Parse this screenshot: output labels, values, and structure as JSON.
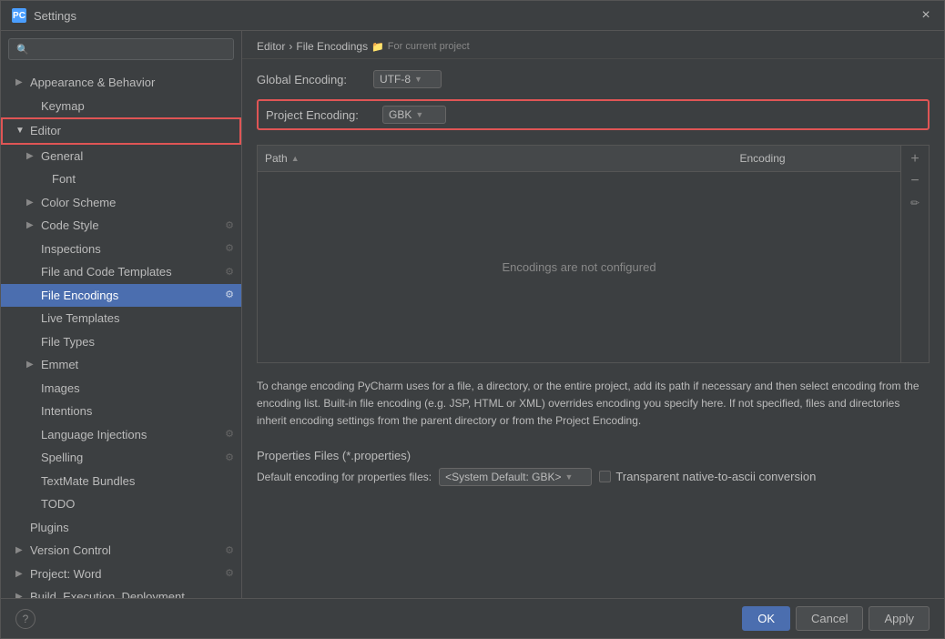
{
  "window": {
    "title": "Settings",
    "close_label": "×"
  },
  "sidebar": {
    "search_placeholder": "",
    "items": [
      {
        "id": "appearance",
        "label": "Appearance & Behavior",
        "level": 0,
        "expandable": true,
        "expanded": false
      },
      {
        "id": "keymap",
        "label": "Keymap",
        "level": 1,
        "expandable": false
      },
      {
        "id": "editor",
        "label": "Editor",
        "level": 0,
        "expandable": true,
        "expanded": true
      },
      {
        "id": "general",
        "label": "General",
        "level": 1,
        "expandable": true,
        "expanded": false
      },
      {
        "id": "font",
        "label": "Font",
        "level": 1,
        "expandable": false
      },
      {
        "id": "colorscheme",
        "label": "Color Scheme",
        "level": 1,
        "expandable": true,
        "expanded": false
      },
      {
        "id": "codestyle",
        "label": "Code Style",
        "level": 1,
        "expandable": true,
        "has_icon": true
      },
      {
        "id": "inspections",
        "label": "Inspections",
        "level": 1,
        "expandable": false,
        "has_icon": true
      },
      {
        "id": "filecodetemplates",
        "label": "File and Code Templates",
        "level": 1,
        "expandable": false,
        "has_icon": true
      },
      {
        "id": "fileencodings",
        "label": "File Encodings",
        "level": 1,
        "expandable": false,
        "selected": true,
        "has_icon": true
      },
      {
        "id": "livetemplates",
        "label": "Live Templates",
        "level": 1,
        "expandable": false
      },
      {
        "id": "filetypes",
        "label": "File Types",
        "level": 1,
        "expandable": false
      },
      {
        "id": "emmet",
        "label": "Emmet",
        "level": 1,
        "expandable": true,
        "expanded": false
      },
      {
        "id": "images",
        "label": "Images",
        "level": 1,
        "expandable": false
      },
      {
        "id": "intentions",
        "label": "Intentions",
        "level": 1,
        "expandable": false
      },
      {
        "id": "languageinjections",
        "label": "Language Injections",
        "level": 1,
        "expandable": false,
        "has_icon": true
      },
      {
        "id": "spelling",
        "label": "Spelling",
        "level": 1,
        "expandable": false,
        "has_icon": true
      },
      {
        "id": "textmatebundles",
        "label": "TextMate Bundles",
        "level": 1,
        "expandable": false
      },
      {
        "id": "todo",
        "label": "TODO",
        "level": 1,
        "expandable": false
      },
      {
        "id": "plugins",
        "label": "Plugins",
        "level": 0,
        "expandable": false
      },
      {
        "id": "versioncontrol",
        "label": "Version Control",
        "level": 0,
        "expandable": true,
        "has_icon": true
      },
      {
        "id": "projectword",
        "label": "Project: Word",
        "level": 0,
        "expandable": true,
        "has_icon": true
      },
      {
        "id": "buildexecution",
        "label": "Build, Execution, Deployment",
        "level": 0,
        "expandable": true
      }
    ]
  },
  "breadcrumb": {
    "parts": [
      "Editor",
      "File Encodings"
    ],
    "separator": "›",
    "project_label": "For current project",
    "folder_icon": "📁"
  },
  "main": {
    "global_encoding_label": "Global Encoding:",
    "global_encoding_value": "UTF-8",
    "project_encoding_label": "Project Encoding:",
    "project_encoding_value": "GBK",
    "table": {
      "path_header": "Path",
      "encoding_header": "Encoding",
      "empty_message": "Encodings are not configured"
    },
    "info_text": "To change encoding PyCharm uses for a file, a directory, or the entire project, add its path if necessary and then select encoding from the encoding list. Built-in file encoding (e.g. JSP, HTML or XML) overrides encoding you specify here. If not specified, files and directories inherit encoding settings from the parent directory or from the Project Encoding.",
    "properties_section_title": "Properties Files (*.properties)",
    "default_encoding_label": "Default encoding for properties files:",
    "default_encoding_value": "<System Default: GBK>",
    "transparent_label": "Transparent native-to-ascii conversion"
  },
  "buttons": {
    "ok": "OK",
    "cancel": "Cancel",
    "apply": "Apply"
  }
}
